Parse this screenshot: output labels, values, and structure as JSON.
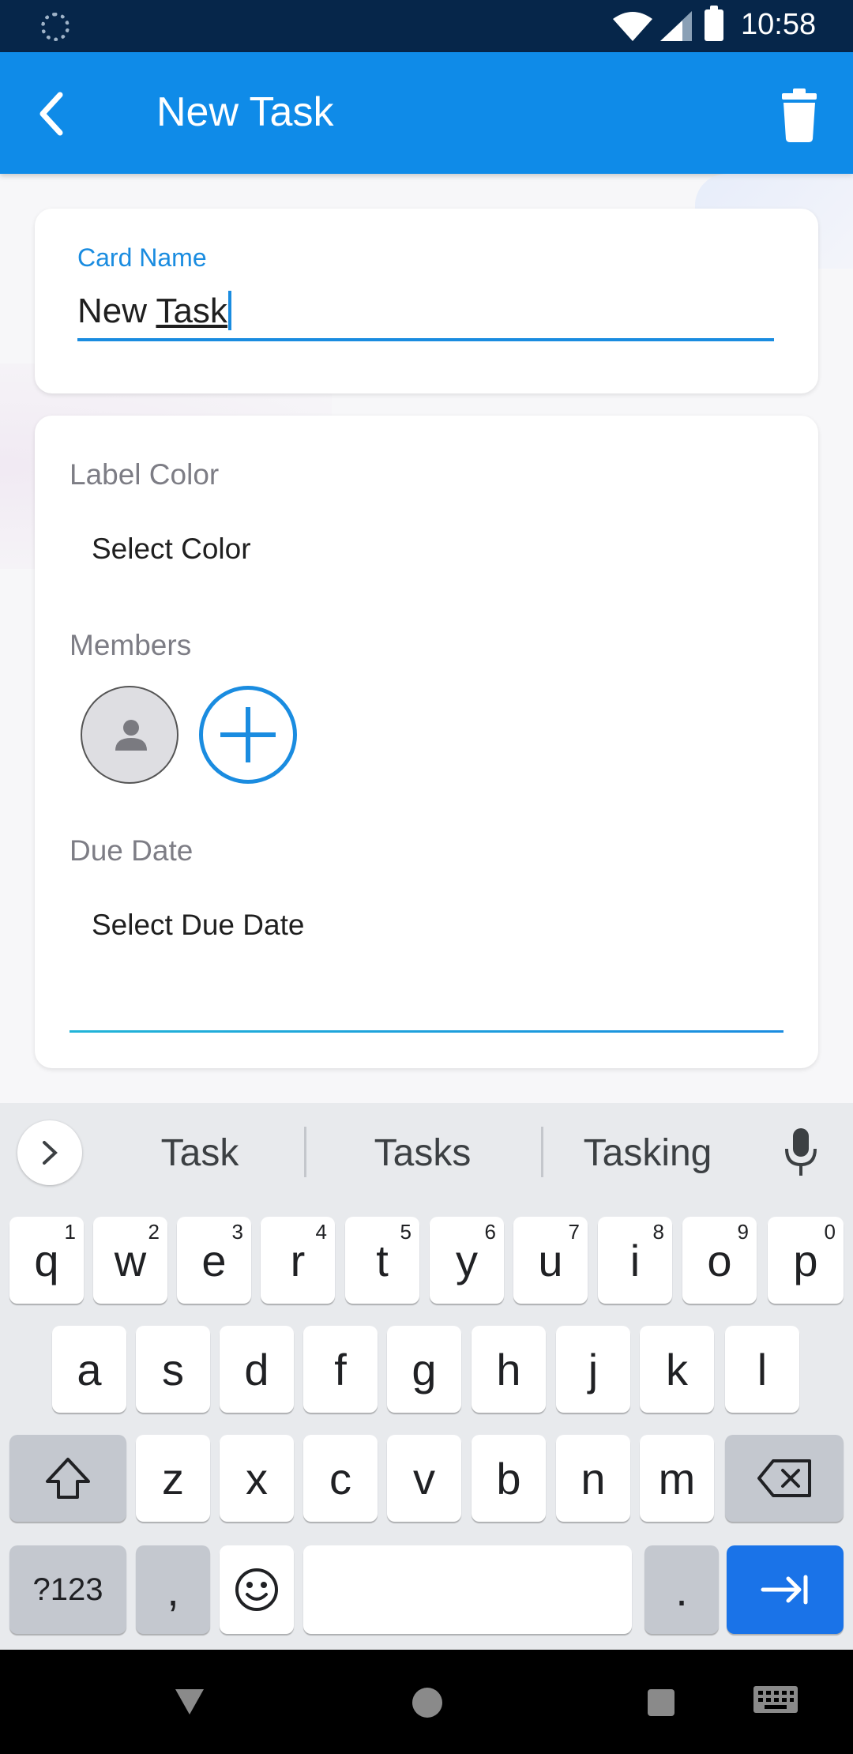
{
  "status_bar": {
    "time": "10:58",
    "icons": [
      "loading-icon",
      "wifi-icon",
      "signal-icon",
      "battery-icon"
    ]
  },
  "app_bar": {
    "title": "New Task",
    "back_icon": "back-arrow-icon",
    "delete_icon": "trash-icon"
  },
  "card_name": {
    "label": "Card Name",
    "value_prefix": "New ",
    "value_underlined": "Task"
  },
  "details": {
    "label_color": {
      "label": "Label Color",
      "value": "Select Color"
    },
    "members": {
      "label": "Members",
      "avatar_icon": "person-icon",
      "add_icon": "plus-icon"
    },
    "due_date": {
      "label": "Due Date",
      "value": "Select Due Date"
    }
  },
  "keyboard": {
    "suggestions": [
      "Task",
      "Tasks",
      "Tasking"
    ],
    "row1": [
      {
        "key": "q",
        "hint": "1"
      },
      {
        "key": "w",
        "hint": "2"
      },
      {
        "key": "e",
        "hint": "3"
      },
      {
        "key": "r",
        "hint": "4"
      },
      {
        "key": "t",
        "hint": "5"
      },
      {
        "key": "y",
        "hint": "6"
      },
      {
        "key": "u",
        "hint": "7"
      },
      {
        "key": "i",
        "hint": "8"
      },
      {
        "key": "o",
        "hint": "9"
      },
      {
        "key": "p",
        "hint": "0"
      }
    ],
    "row2": [
      "a",
      "s",
      "d",
      "f",
      "g",
      "h",
      "j",
      "k",
      "l"
    ],
    "row3": [
      "z",
      "x",
      "c",
      "v",
      "b",
      "n",
      "m"
    ],
    "symbols_label": "?123",
    "comma": ",",
    "period": "."
  },
  "colors": {
    "app_bar": "#0f8be8",
    "status_bar": "#06264a",
    "accent": "#1a8ce0",
    "enter_key": "#1a73e8"
  }
}
